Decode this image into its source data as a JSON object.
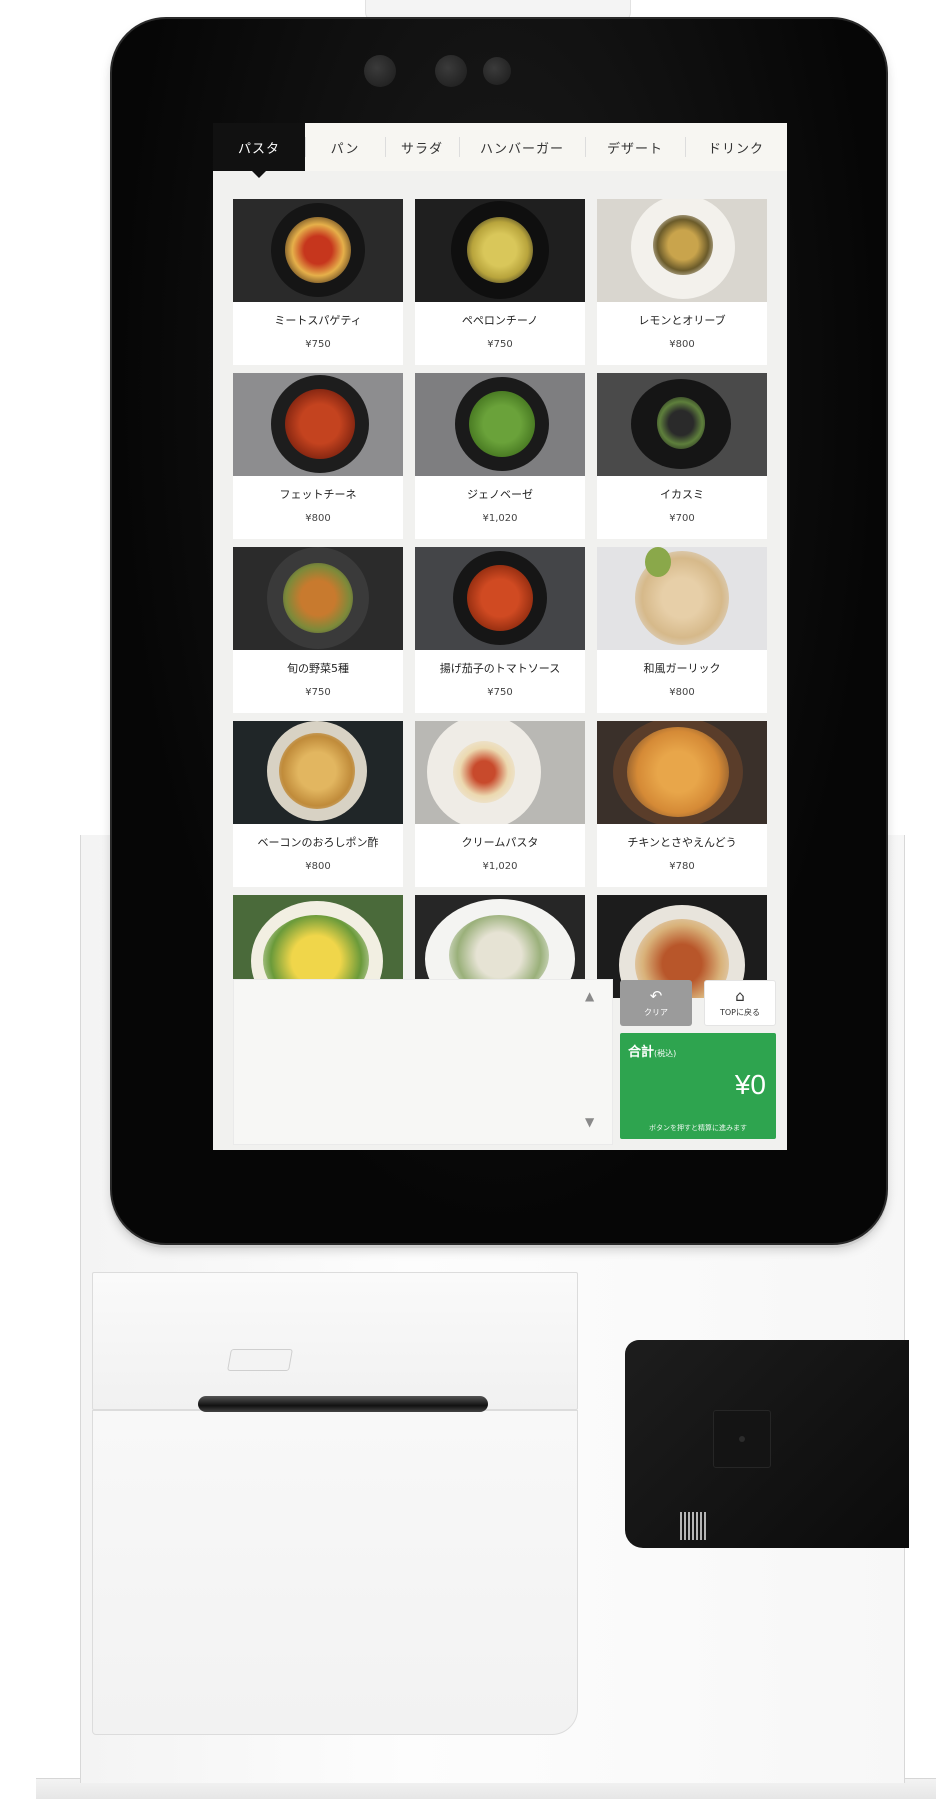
{
  "tabs": [
    {
      "label": "パスタ",
      "active": true
    },
    {
      "label": "パン",
      "active": false
    },
    {
      "label": "サラダ",
      "active": false
    },
    {
      "label": "ハンバーガー",
      "active": false
    },
    {
      "label": "デザート",
      "active": false
    },
    {
      "label": "ドリンク",
      "active": false
    }
  ],
  "menu_items": [
    {
      "name": "ミートスパゲティ",
      "price": "¥750"
    },
    {
      "name": "ペペロンチーノ",
      "price": "¥750"
    },
    {
      "name": "レモンとオリーブ",
      "price": "¥800"
    },
    {
      "name": "フェットチーネ",
      "price": "¥800"
    },
    {
      "name": "ジェノベーゼ",
      "price": "¥1,020"
    },
    {
      "name": "イカスミ",
      "price": "¥700"
    },
    {
      "name": "旬の野菜5種",
      "price": "¥750"
    },
    {
      "name": "揚げ茄子のトマトソース",
      "price": "¥750"
    },
    {
      "name": "和風ガーリック",
      "price": "¥800"
    },
    {
      "name": "ベーコンのおろしポン酢",
      "price": "¥800"
    },
    {
      "name": "クリームパスタ",
      "price": "¥1,020"
    },
    {
      "name": "チキンとさやえんどう",
      "price": "¥780"
    }
  ],
  "controls": {
    "scroll_up_icon": "triangle-up-icon",
    "scroll_down_icon": "triangle-down-icon",
    "clear_label": "クリア",
    "top_label": "TOPに戻る"
  },
  "total": {
    "label": "合計",
    "tax_note": "(税込)",
    "amount": "¥0",
    "note": "ボタンを押すと精算に進みます"
  },
  "colors": {
    "accent_green": "#2ea44f",
    "tab_active": "#111111",
    "clear_button": "#9b9b9b"
  }
}
